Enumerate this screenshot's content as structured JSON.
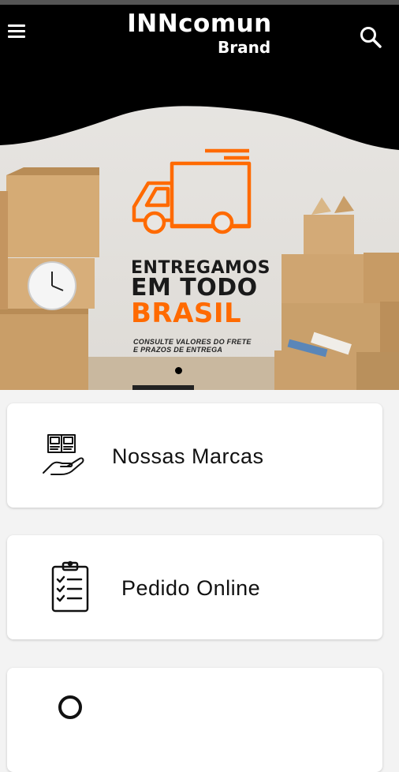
{
  "header": {
    "brand_line1": "INNcomun",
    "brand_line2": "Brand"
  },
  "banner": {
    "headline_line1": "ENTREGAMOS",
    "headline_line2": "EM TODO",
    "headline_line3": "BRASIL",
    "sub_line1": "CONSULTE VALORES DO FRETE",
    "sub_line2": "E PRAZOS DE ENTREGA",
    "slide_index": 1,
    "accent_color": "#ff6a00"
  },
  "cards": [
    {
      "label": "Nossas Marcas",
      "icon": "catalog-hand-icon"
    },
    {
      "label": "Pedido Online",
      "icon": "clipboard-checklist-icon"
    },
    {
      "label": "",
      "icon": "search-icon"
    }
  ]
}
